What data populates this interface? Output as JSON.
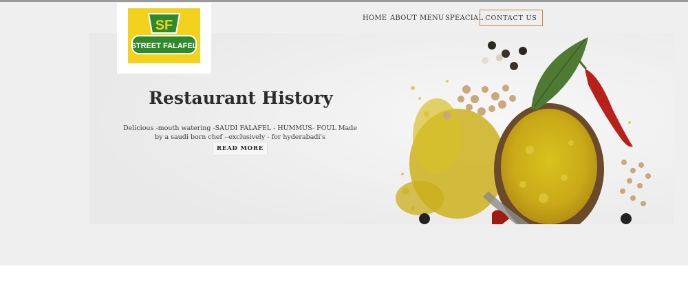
{
  "brand": {
    "logo_text_top": "SF",
    "logo_text_bottom": "STREET FALAFEL"
  },
  "nav": {
    "items": [
      "HOME",
      "ABOUT",
      "MENU",
      "SPEACIAL"
    ],
    "contact": "CONTACT US"
  },
  "hero": {
    "title": "Restaurant History",
    "description": "Delicious -mouth watering -SAUDI FALAFEL - HUMMUS- FOUL Made by a saudi born chef --exclusively - for hyderabadi's",
    "button": "READ MORE"
  },
  "colors": {
    "logo_yellow": "#f2d21c",
    "logo_green": "#2f8a2d",
    "accent_border": "#c58a4a"
  }
}
